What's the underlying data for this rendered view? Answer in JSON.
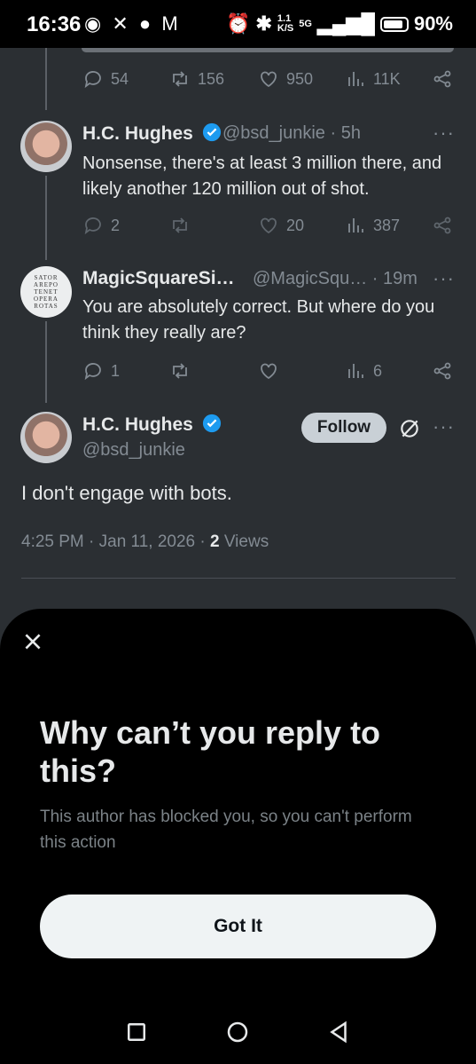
{
  "status_bar": {
    "time": "16:36",
    "left_icons": [
      "eye-icon",
      "missed-call-icon",
      "chat-bubble-icon",
      "gmail-icon"
    ],
    "speed_top": "1.1",
    "speed_bottom": "K/S",
    "network": "5G",
    "battery": "90%"
  },
  "thread": [
    {
      "stats": {
        "replies": "54",
        "reposts": "156",
        "likes": "950",
        "views": "11K"
      }
    },
    {
      "name": "H.C. Hughes",
      "handle": "@bsd_junkie · 5h",
      "text": "Nonsense, there's at least 3 million there, and likely another 120 million out of shot.",
      "stats": {
        "replies": "2",
        "reposts": "",
        "likes": "20",
        "views": "387"
      }
    },
    {
      "name": "MagicSquareSi…",
      "handle": "@MagicSqu… · 19m",
      "text": "You are absolutely correct. But where do you think they really are?",
      "avatar_text": "SATOR AREPO TENET OPERA ROTAS",
      "stats": {
        "replies": "1",
        "reposts": "",
        "likes": "",
        "views": "6"
      }
    }
  ],
  "main_tweet": {
    "name": "H.C. Hughes",
    "handle": "@bsd_junkie",
    "follow_label": "Follow",
    "text": "I don't engage with bots.",
    "time": "4:25 PM · Jan 11, 2026 · ",
    "views_count": "2",
    "views_label": " Views"
  },
  "sheet": {
    "title": "Why can’t you reply to this?",
    "body": "This author has blocked you, so you can't perform this action",
    "button": "Got It"
  },
  "nav_bar": [
    "recents-square-icon",
    "home-circle-icon",
    "back-triangle-icon"
  ],
  "colors": {
    "background": "#2b2f33",
    "sheet": "#000000",
    "verified": "#1d9bf0",
    "muted_text": "#838b93",
    "button_light": "#eff3f4"
  }
}
